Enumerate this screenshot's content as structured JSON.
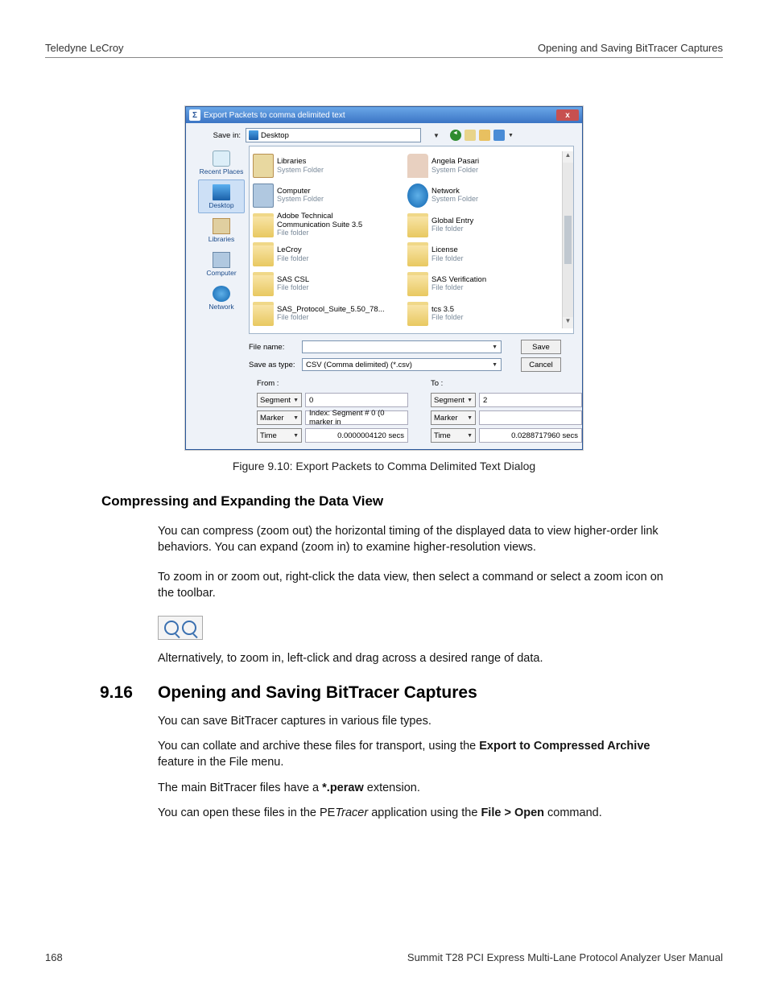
{
  "header": {
    "left": "Teledyne LeCroy",
    "right": "Opening and Saving BitTracer Captures"
  },
  "dialog": {
    "title": "Export Packets to comma delimited text",
    "close": "x",
    "savein_label": "Save in:",
    "savein_value": "Desktop",
    "toolbar_icons": [
      "back-icon",
      "up-one-level-icon",
      "create-new-folder-icon",
      "view-menu-icon"
    ],
    "places": [
      {
        "label": "Recent Places",
        "icon": "pi-recent"
      },
      {
        "label": "Desktop",
        "icon": "pi-desktop"
      },
      {
        "label": "Libraries",
        "icon": "pi-lib"
      },
      {
        "label": "Computer",
        "icon": "pi-comp"
      },
      {
        "label": "Network",
        "icon": "pi-net"
      }
    ],
    "files_col1": [
      {
        "name": "Libraries",
        "sub": "System Folder",
        "icon": "folder-lib"
      },
      {
        "name": "Computer",
        "sub": "System Folder",
        "icon": "comp"
      },
      {
        "name": "Adobe Technical Communication Suite 3.5",
        "sub": "File folder",
        "icon": "folder",
        "wrap": true
      },
      {
        "name": "LeCroy",
        "sub": "File folder",
        "icon": "folder"
      },
      {
        "name": "SAS CSL",
        "sub": "File folder",
        "icon": "folder"
      },
      {
        "name": "SAS_Protocol_Suite_5.50_78...",
        "sub": "File folder",
        "icon": "folder"
      }
    ],
    "files_col2": [
      {
        "name": "Angela Pasari",
        "sub": "System Folder",
        "icon": "user"
      },
      {
        "name": "Network",
        "sub": "System Folder",
        "icon": "net"
      },
      {
        "name": "Global Entry",
        "sub": "File folder",
        "icon": "folder"
      },
      {
        "name": "License",
        "sub": "File folder",
        "icon": "folder"
      },
      {
        "name": "SAS Verification",
        "sub": "File folder",
        "icon": "folder"
      },
      {
        "name": "tcs 3.5",
        "sub": "File folder",
        "icon": "folder"
      }
    ],
    "filename_label": "File name:",
    "filename_value": "",
    "saveas_label": "Save as type:",
    "saveas_value": "CSV (Comma delimited) (*.csv)",
    "save_btn": "Save",
    "cancel_btn": "Cancel",
    "from_label": "From :",
    "to_label": "To :",
    "from": {
      "segment": "Segment",
      "segment_val": "0",
      "marker": "Marker",
      "marker_val": "Index: Segment # 0 (0 marker in",
      "time": "Time",
      "time_val": "0.0000004120 secs"
    },
    "to": {
      "segment": "Segment",
      "segment_val": "2",
      "marker": "Marker",
      "marker_val": "",
      "time": "Time",
      "time_val": "0.0288717960 secs"
    }
  },
  "caption": "Figure 9.10:  Export Packets to Comma Delimited Text Dialog",
  "subhead": "Compressing and Expanding the Data View",
  "para1": "You can compress (zoom out) the horizontal timing of the displayed data to view higher-order link behaviors. You can expand (zoom in) to examine higher-resolution views.",
  "para2": "To zoom in or zoom out, right-click the data view, then select a command or select a zoom icon on the toolbar.",
  "para3": "Alternatively, to zoom in, left-click and drag across a desired range of data.",
  "section": {
    "num": "9.16",
    "title": "Opening and Saving BitTracer Captures"
  },
  "para4": "You can save BitTracer captures in various file types.",
  "para5a": "You can collate and archive these files for transport, using the ",
  "para5b": "Export to Compressed Archive",
  "para5c": " feature in the File menu.",
  "para6a": "The main BitTracer files have a ",
  "para6b": "*.peraw",
  "para6c": " extension.",
  "para7a": "You can open these files in the PE",
  "para7b": "Tracer",
  "para7c": " application using the ",
  "para7d": "File > Open",
  "para7e": " command.",
  "footer": {
    "page": "168",
    "doc": "Summit T28 PCI Express Multi-Lane Protocol Analyzer User Manual"
  }
}
